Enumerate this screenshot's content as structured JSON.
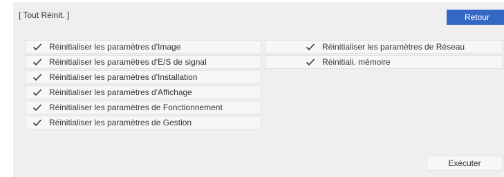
{
  "header": {
    "title": "[ Tout Réinit. ]",
    "back_label": "Retour"
  },
  "options_left": [
    {
      "label": "Réinitialiser les paramètres d'Image",
      "checked": true
    },
    {
      "label": "Réinitialiser les paramètres d'E/S de signal",
      "checked": true
    },
    {
      "label": "Réinitialiser les paramètres d'Installation",
      "checked": true
    },
    {
      "label": "Réinitialiser les paramètres d'Affichage",
      "checked": true
    },
    {
      "label": "Réinitialiser les paramètres de Fonctionnement",
      "checked": true
    },
    {
      "label": "Réinitialiser les paramètres de Gestion",
      "checked": true
    }
  ],
  "options_right": [
    {
      "label": "Réinitialiser les paramètres de Réseau",
      "checked": true
    },
    {
      "label": "Réinitiali. mémoire",
      "checked": true
    }
  ],
  "footer": {
    "execute_label": "Exécuter"
  },
  "colors": {
    "accent": "#3568c5",
    "panel_background": "#efeff0",
    "item_background": "#f7f7f8"
  },
  "icons": {
    "item_check": "check-icon"
  }
}
